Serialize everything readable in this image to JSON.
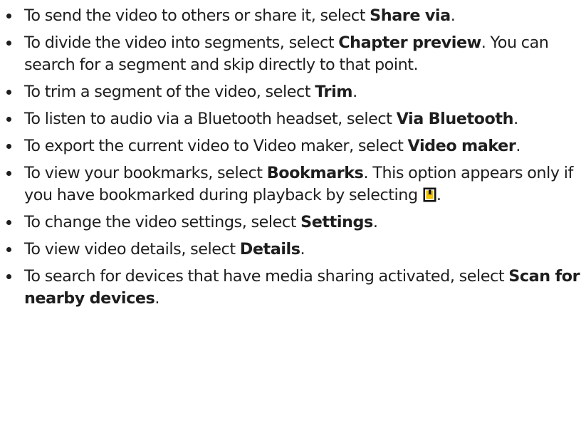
{
  "bullets": [
    {
      "lead": "To send the video to others or share it, select ",
      "bold": "Share via",
      "tail": "."
    },
    {
      "lead": "To divide the video into segments, select ",
      "bold": "Chapter preview",
      "tail": ". You can search for a segment and skip directly to that point."
    },
    {
      "lead": "To trim a segment of the video, select ",
      "bold": "Trim",
      "tail": "."
    },
    {
      "lead": "To listen to audio via a Bluetooth headset, select ",
      "bold": "Via Bluetooth",
      "tail": "."
    },
    {
      "lead": "To export the current video to Video maker, select ",
      "bold": "Video maker",
      "tail": "."
    },
    {
      "lead": "To view your bookmarks, select ",
      "bold": "Bookmarks",
      "tail": ". This option appears only if you have bookmarked during playback by selecting ",
      "icon": "bookmark-icon",
      "end": "."
    },
    {
      "lead": "To change the video settings, select ",
      "bold": "Settings",
      "tail": "."
    },
    {
      "lead": "To view video details, select ",
      "bold": "Details",
      "tail": "."
    },
    {
      "lead": "To search for devices that have media sharing activated, select ",
      "bold": "Scan for nearby devices",
      "tail": "."
    }
  ],
  "colors": {
    "text": "#1e1e1e",
    "icon_fill": "#f2c300"
  }
}
